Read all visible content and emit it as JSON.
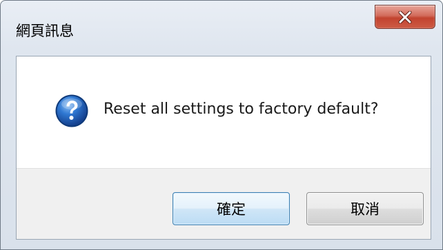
{
  "dialog": {
    "title": "網頁訊息",
    "message": "Reset all settings to factory default?",
    "icon": "question-icon"
  },
  "titlebar": {
    "close_icon": "close-icon"
  },
  "buttons": {
    "ok_label": "確定",
    "cancel_label": "取消"
  },
  "colors": {
    "close_button": "#c2432f",
    "ok_button_border": "#3c7fb1",
    "icon_blue": "#1f5fb4",
    "footer_background": "#f0f0f0"
  }
}
